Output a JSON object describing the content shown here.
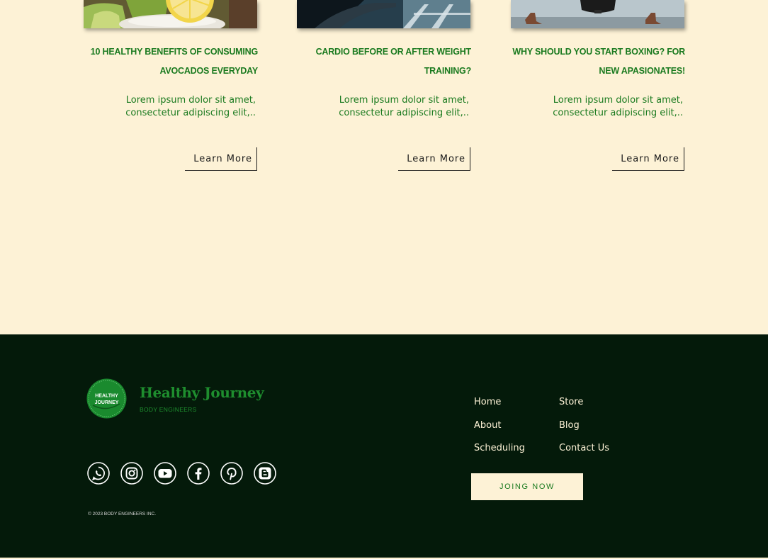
{
  "posts": [
    {
      "image": "avocado-slices-image",
      "title": "10 HEALTHY BENEFITS OF CONSUMING AVOCADOS EVERYDAY",
      "excerpt": "Lorem ipsum dolor sit amet, consectetur adipiscing elit,..",
      "button_label": "Learn More"
    },
    {
      "image": "treadmill-image",
      "title": "CARDIO BEFORE OR AFTER WEIGHT TRAINING?",
      "excerpt": "Lorem ipsum dolor sit amet, consectetur adipiscing elit,..",
      "button_label": "Learn More"
    },
    {
      "image": "boxing-bag-image",
      "title": "WHY SHOULD YOU START BOXING? FOR NEW APASIONATES!",
      "excerpt": "Lorem ipsum dolor sit amet, consectetur adipiscing elit,..",
      "button_label": "Learn More"
    }
  ],
  "footer": {
    "logo_badge_line1": "HEALTHY",
    "logo_badge_line2": "JOURNEY",
    "brand_name": "Healthy Journey",
    "brand_subtitle": "BODY ENGINEERS",
    "social_icons": [
      "whatsapp-icon",
      "instagram-icon",
      "youtube-icon",
      "facebook-icon",
      "pinterest-icon",
      "blogger-icon"
    ],
    "nav": {
      "home": "Home",
      "about": "About",
      "scheduling": "Scheduling",
      "store": "Store",
      "blog": "Blog",
      "contact": "Contact Us"
    },
    "join_label": "JOING NOW",
    "copyright": "© 2023 BODY ENGINEERS INC."
  },
  "colors": {
    "background": "#fdf2d6",
    "brand_green": "#1a7a1f",
    "footer_background": "#041a0a",
    "text_dark": "#1a1a1a"
  }
}
